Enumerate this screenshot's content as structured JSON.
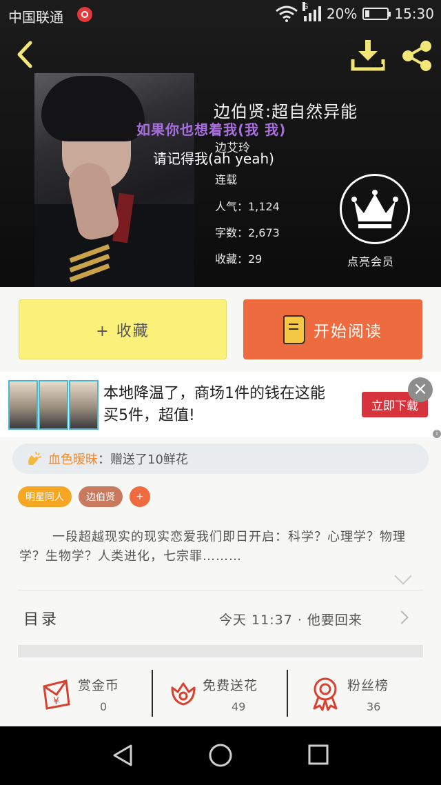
{
  "status_bar": {
    "carrier": "中国联通",
    "signal_type": "G",
    "battery": "20%",
    "battery_level": 0.2,
    "time": "15:30"
  },
  "book": {
    "title": "边伯贤:超自然异能",
    "author": "边艾玲",
    "status": "连载",
    "popularity": "人气：1,124",
    "word_count": "字数：2,673",
    "favorites": "收藏：29",
    "overlay_lyric_1": "如果你也想着我(我 我)",
    "overlay_lyric_2": "请记得我(ah yeah)",
    "vip_label": "点亮会员"
  },
  "actions": {
    "favorite_label": "+ 收藏",
    "read_label": "开始阅读"
  },
  "ad": {
    "text_line1": "本地降温了，商场1件的钱在这能",
    "text_line2": "买5件，超值!",
    "cta": "立即下载"
  },
  "gift": {
    "user": "血色暧昧",
    "message": "：赠送了10鲜花"
  },
  "tags": [
    {
      "label": "明星同人",
      "color": "#f5a623"
    },
    {
      "label": "边伯贤",
      "color": "#c8795e"
    },
    {
      "label": "+",
      "color": "#ee6b3f"
    }
  ],
  "description": "一段超越现实的现实恋爱我们即日开启：科学？心理学？物理学？生物学？人类进化，七宗罪………",
  "toc": {
    "label": "目录",
    "latest": "今天 11:37 · 他要回来"
  },
  "stats": {
    "coins_label": "赏金币",
    "coins_value": "0",
    "flowers_label": "免费送花",
    "flowers_value": "49",
    "fans_label": "粉丝榜",
    "fans_value": "36"
  },
  "colors": {
    "accent_orange": "#ee6b3f",
    "favorite_yellow": "#fbf17a",
    "icon_red": "#d9402e"
  }
}
